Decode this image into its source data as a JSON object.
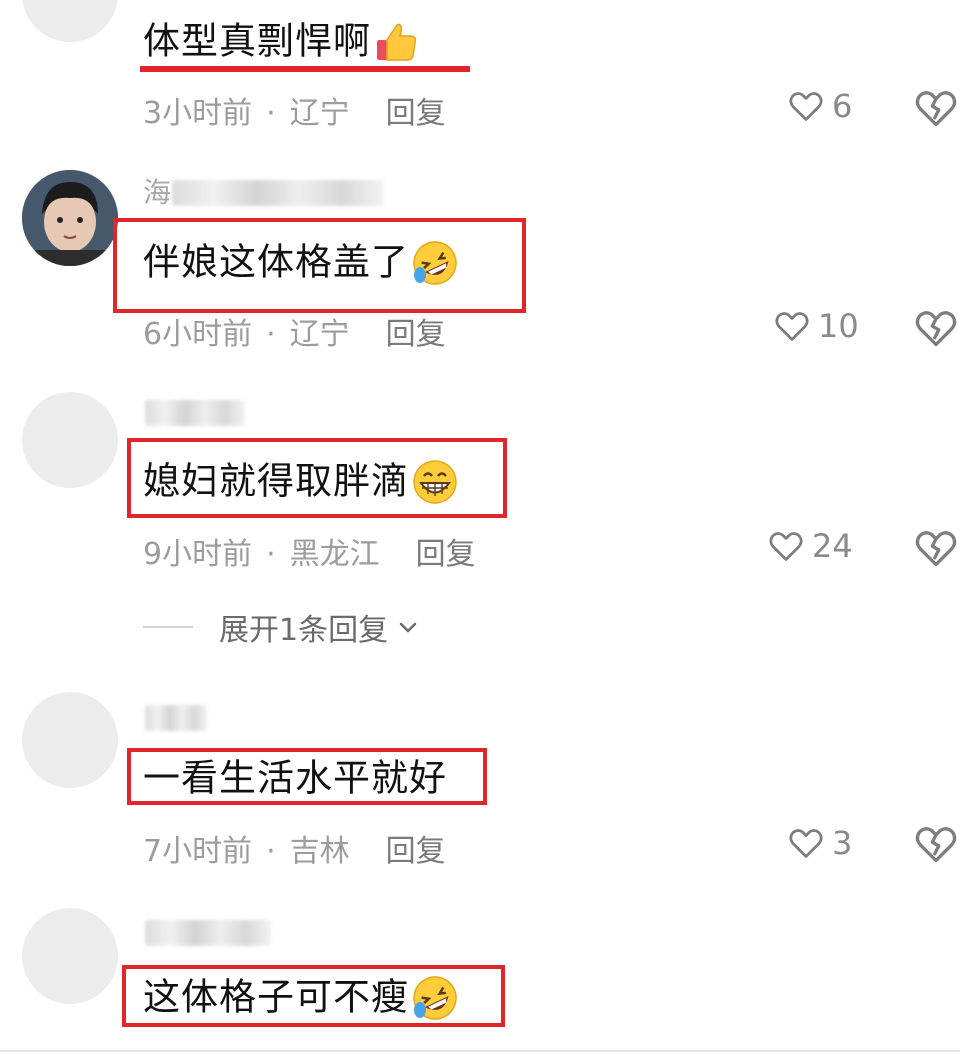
{
  "comments": [
    {
      "text": "体型真剽悍啊",
      "emoji": "thumbs-up-emoji",
      "time": "3小时前",
      "location": "辽宁",
      "reply_label": "回复",
      "likes": "6",
      "highlight": "underline"
    },
    {
      "username_partial": "海",
      "text": "伴娘这体格盖了",
      "emoji": "rolling-on-floor-laughing-emoji",
      "time": "6小时前",
      "location": "辽宁",
      "reply_label": "回复",
      "likes": "10",
      "highlight": "box"
    },
    {
      "text": "媳妇就得取胖滴",
      "emoji": "grinning-face-emoji",
      "time": "9小时前",
      "location": "黑龙江",
      "reply_label": "回复",
      "likes": "24",
      "expand_label": "展开1条回复",
      "highlight": "box"
    },
    {
      "text": "一看生活水平就好",
      "time": "7小时前",
      "location": "吉林",
      "reply_label": "回复",
      "likes": "3",
      "highlight": "box"
    },
    {
      "text": "这体格子可不瘦",
      "emoji": "rolling-on-floor-laughing-emoji",
      "highlight": "box"
    }
  ],
  "meta_separator": "·",
  "colors": {
    "highlight": "#e0262b",
    "meta_text": "#9c9c9c",
    "body_text": "#111111"
  }
}
